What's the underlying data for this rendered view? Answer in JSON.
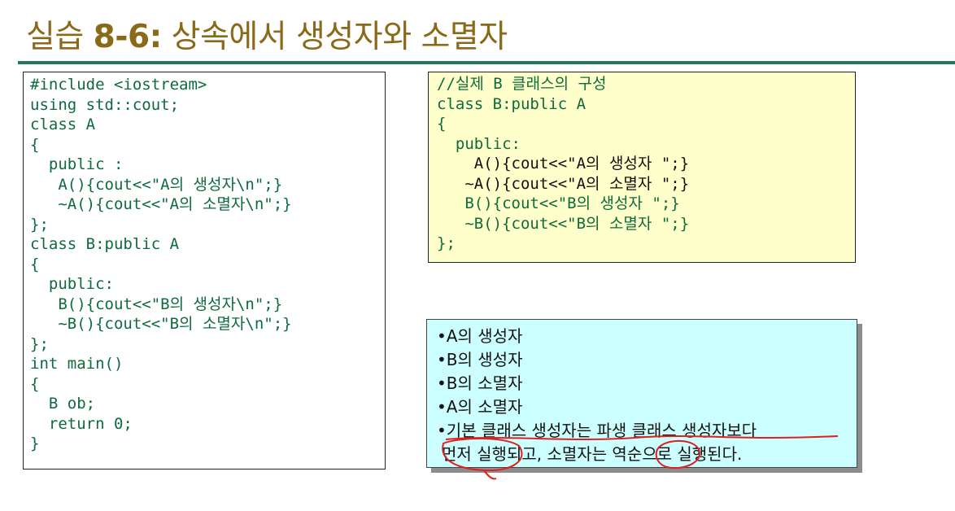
{
  "title": {
    "prefix": "실습 ",
    "number": "8-6:",
    "text": " 상속에서 생성자와 소멸자"
  },
  "code_left": [
    "#include <iostream>",
    "using std::cout;",
    "class A",
    "{",
    "  public :",
    "   A(){cout<<\"A의 생성자\\n\";}",
    "   ~A(){cout<<\"A의 소멸자\\n\";}",
    "};",
    "class B:public A",
    "{",
    "  public:",
    "   B(){cout<<\"B의 생성자\\n\";}",
    "   ~B(){cout<<\"B의 소멸자\\n\";}",
    "};",
    "int main()",
    "{",
    "  B ob;",
    "  return 0;",
    "}"
  ],
  "code_right": [
    "//실제 B 클래스의 구성",
    "class B:public A",
    "{",
    "  public:",
    "    A(){cout<<\"A의 생성자 \";}",
    "   ~A(){cout<<\"A의 소멸자 \";}",
    "   B(){cout<<\"B의 생성자 \";}",
    "   ~B(){cout<<\"B의 소멸자 \";}",
    "};"
  ],
  "output": {
    "items": [
      "•A의 생성자",
      "•B의 생성자",
      "•B의 소멸자",
      "•A의 소멸자",
      "•기본 클래스 생성자는 파생 클래스 생성자보다"
    ],
    "continuation": "먼저 실행되고, 소멸자는 역순으로 실행된다."
  },
  "colors": {
    "title": "#8a6a1a",
    "rule": "#1f7a5c",
    "code": "#0d6b3d",
    "yellow_box": "#ffffcc",
    "cyan_box": "#ccffff",
    "annotation": "#e02020"
  }
}
